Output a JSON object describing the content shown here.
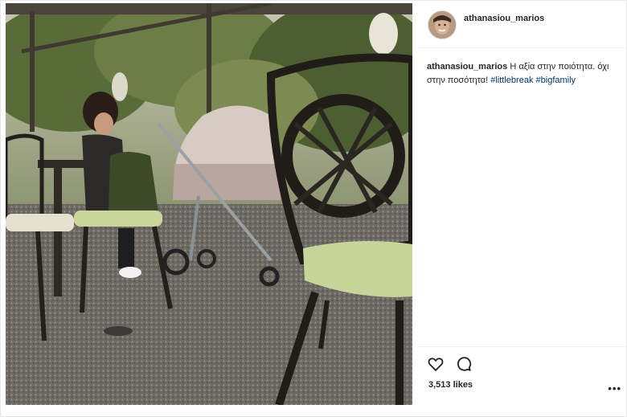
{
  "post": {
    "username": "athanasiou_marios",
    "caption": {
      "username": "athanasiou_marios",
      "text": " Η αξία στην ποιότητα. όχι στην ποσότητα!",
      "hashtags": [
        "#littlebreak",
        "#bigfamily"
      ]
    },
    "likes_text": "3,513 likes",
    "more_label": "•••"
  },
  "icons": {
    "like": "heart-outline-icon",
    "comment": "comment-bubble-icon",
    "more": "ellipsis-icon"
  },
  "colors": {
    "hashtag": "#003569",
    "text": "#262626",
    "divider": "#efefef"
  }
}
